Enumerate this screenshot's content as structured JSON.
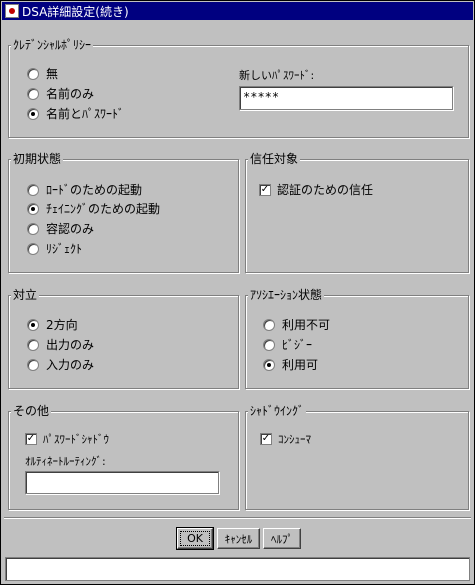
{
  "window": {
    "title": "DSA詳細設定(続き)"
  },
  "credential_policy": {
    "legend": "ｸﾚﾃﾞﾝｼｬﾙﾎﾟﾘｼｰ",
    "options": [
      "無",
      "名前のみ",
      "名前とﾊﾟｽﾜｰﾄﾞ"
    ],
    "selected": "名前とﾊﾟｽﾜｰﾄﾞ",
    "new_password_label": "新しいﾊﾟｽﾜｰﾄﾞ:",
    "new_password_value": "*****"
  },
  "initial_state": {
    "legend": "初期状態",
    "options": [
      "ﾛｰﾄﾞのための起動",
      "ﾁｪｲﾆﾝｸﾞのための起動",
      "容認のみ",
      "ﾘｼﾞｪｸﾄ"
    ],
    "selected": "ﾁｪｲﾆﾝｸﾞのための起動"
  },
  "trust": {
    "legend": "信任対象",
    "checkbox_label": "認証のための信任",
    "checked": true
  },
  "peer": {
    "legend": "対立",
    "options": [
      "2方向",
      "出力のみ",
      "入力のみ"
    ],
    "selected": "2方向"
  },
  "association": {
    "legend": "ｱｿｼｴｰｼｮﾝ状態",
    "options": [
      "利用不可",
      "ﾋﾞｼﾞｰ",
      "利用可"
    ],
    "selected": "利用可"
  },
  "other": {
    "legend": "その他",
    "checkbox_label": "ﾊﾟｽﾜｰﾄﾞｼｬﾄﾞｳ",
    "checked": true,
    "routing_label": "ｵﾙﾃｨﾈｰﾄﾙｰﾃｨﾝｸﾞ:",
    "routing_value": ""
  },
  "shadowing": {
    "legend": "ｼｬﾄﾞｳｲﾝｸﾞ",
    "checkbox_label": "ｺﾝｼｭｰﾏ",
    "checked": true
  },
  "buttons": {
    "ok": "OK",
    "cancel": "ｷｬﾝｾﾙ",
    "help": "ﾍﾙﾌﾟ"
  },
  "status_text": ""
}
